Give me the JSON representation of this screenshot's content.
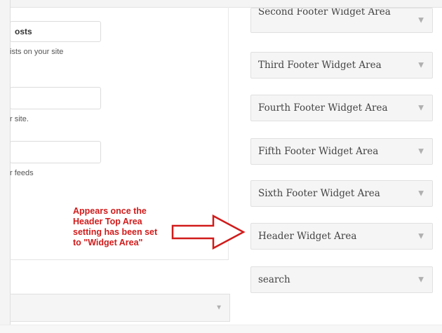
{
  "left_panel": {
    "posts_field_value": "osts",
    "posts_description": "ists on your site",
    "site_description": "r site.",
    "feeds_description": "r feeds"
  },
  "widget_areas": [
    {
      "label": "Second Footer Widget Area"
    },
    {
      "label": "Third Footer Widget Area"
    },
    {
      "label": "Fourth Footer Widget Area"
    },
    {
      "label": "Fifth Footer Widget Area"
    },
    {
      "label": "Sixth Footer Widget Area"
    },
    {
      "label": "Header Widget Area"
    },
    {
      "label": "search"
    }
  ],
  "dropdown_indicator": "▼",
  "annotation": {
    "text": "Appears once the\nHeader Top Area\nsetting has been set\nto \"Widget Area\"",
    "color": "#d11b1b"
  }
}
